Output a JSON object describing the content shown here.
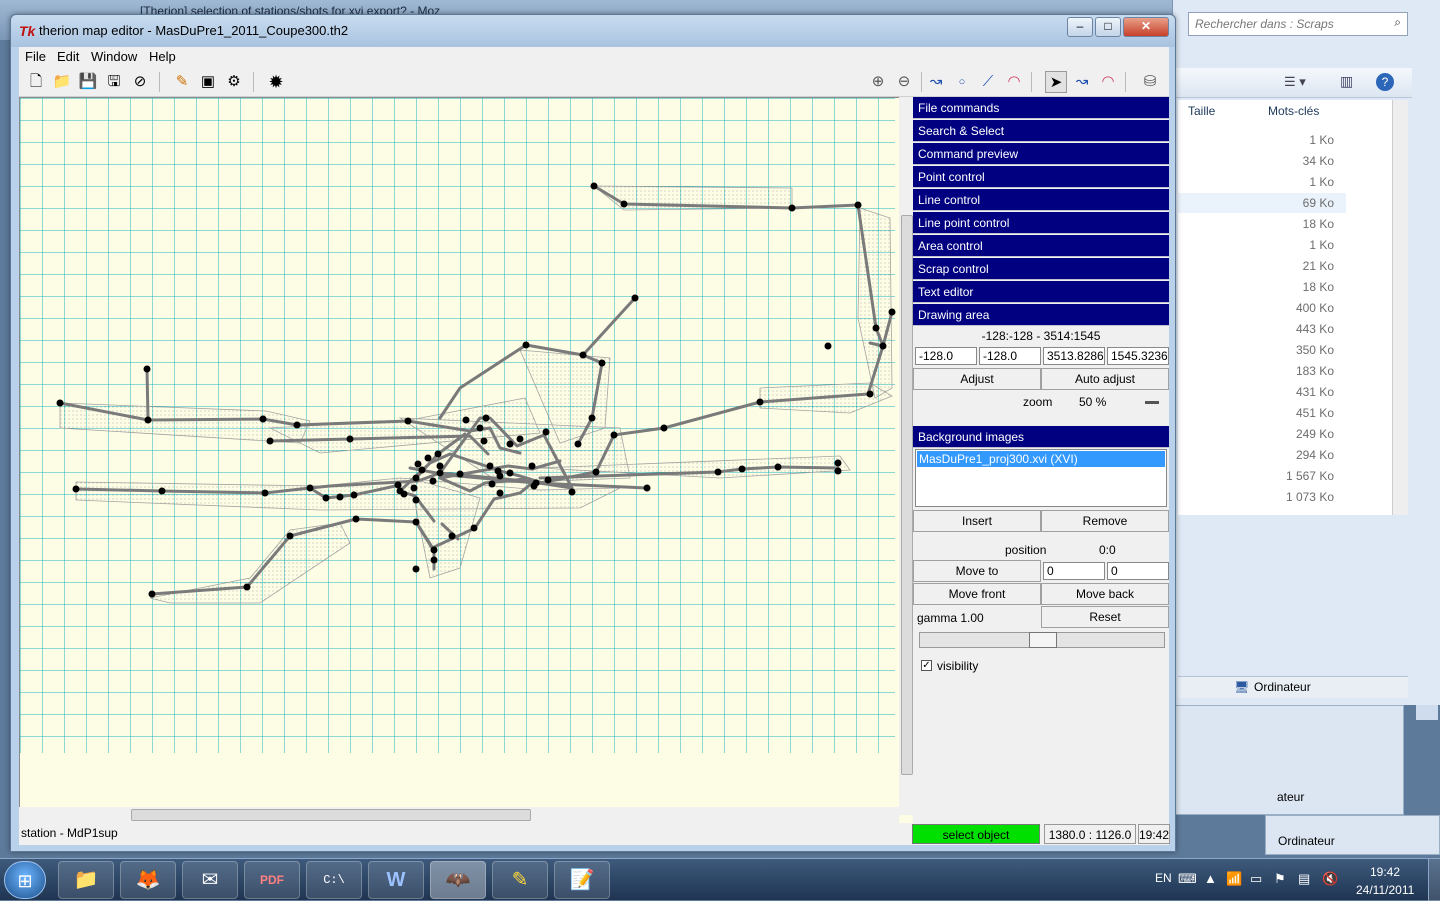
{
  "background": {
    "browser_tab_title": "[Therion] selection of stations/shots for xvi export? - Moz",
    "explorer": {
      "search_placeholder": "Rechercher dans : Scraps",
      "col_size": "Taille",
      "col_keywords": "Mots-clés",
      "sizes": [
        "1 Ko",
        "34 Ko",
        "1 Ko",
        "69 Ko",
        "18 Ko",
        "1 Ko",
        "21 Ko",
        "18 Ko",
        "400 Ko",
        "443 Ko",
        "350 Ko",
        "183 Ko",
        "431 Ko",
        "451 Ko",
        "249 Ko",
        "294 Ko",
        "1 567 Ko",
        "1 073 Ko"
      ],
      "status_computer": "Ordinateur",
      "status2_partial": "ateur",
      "status3_computer": "Ordinateur"
    }
  },
  "window": {
    "title": "therion map editor - MasDuPre1_2011_Coupe300.th2",
    "icon_label": "Tk",
    "minimize": "–",
    "maximize": "□",
    "close": "✕"
  },
  "menu": [
    "File",
    "Edit",
    "Window",
    "Help"
  ],
  "toolbar": {
    "file_tools": [
      "new-file-icon",
      "open-file-icon",
      "save-file-icon",
      "save-as-icon",
      "close-file-icon"
    ],
    "edit_tools": [
      "edit-pencil-icon",
      "preview-icon",
      "compile-icon"
    ],
    "settings": "gear-icon",
    "zoom_in": "⊕",
    "zoom_out": "⊖",
    "draw_tools": [
      "insert-point-icon",
      "insert-line-icon",
      "insert-area-icon"
    ],
    "select_tools": [
      "select-arrow-icon",
      "select-line-icon",
      "select-area-icon"
    ],
    "bucket": "database-icon"
  },
  "panel": {
    "sections": [
      "File commands",
      "Search & Select",
      "Command preview",
      "Point control",
      "Line control",
      "Line point control",
      "Area control",
      "Scrap control",
      "Text editor",
      "Drawing area"
    ],
    "drawing_area": {
      "range_label": "-128:-128 - 3514:1545",
      "x1": "-128.0",
      "y1": "-128.0",
      "x2": "3513.8286",
      "y2": "1545.3236",
      "adjust": "Adjust",
      "auto_adjust": "Auto adjust",
      "zoom_label": "zoom",
      "zoom_value": "50 %"
    },
    "background_images": {
      "title": "Background images",
      "items": [
        "MasDuPre1_proj300.xvi (XVI)"
      ],
      "insert": "Insert",
      "remove": "Remove",
      "position_label": "position",
      "position_value": "0:0",
      "move_to": "Move to",
      "move_x": "0",
      "move_y": "0",
      "move_front": "Move front",
      "move_back": "Move back",
      "gamma_label": "gamma 1.00",
      "reset": "Reset",
      "gamma_slider": 0.5,
      "visibility_label": "visibility",
      "visibility_checked": "✓"
    }
  },
  "status": {
    "object": "station - MdP1sup",
    "mode": "select object",
    "coords": "1380.0 : 1126.0",
    "time": "19:42"
  },
  "taskbar": {
    "start": "⊞",
    "apps": [
      "📁",
      "🦊",
      "✉",
      "PDF",
      "C:\\",
      "W",
      "🦇",
      "✎",
      "📝"
    ],
    "lang": "EN",
    "clock_time": "19:42",
    "clock_date": "24/11/2011"
  },
  "colors": {
    "grid": "#1bb3bf",
    "canvas_bg": "#fdfde6",
    "section_bg": "#000080",
    "mode_green": "#00e000"
  }
}
